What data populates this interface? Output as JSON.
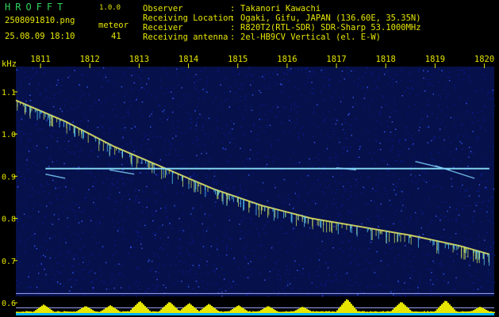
{
  "header": {
    "logo": "HROFFT",
    "version": "1.0.0",
    "filename": "2508091810.png",
    "datetime": "25.08.09 18:10",
    "meteor_label": "meteor",
    "meteor_count": "41",
    "info": [
      {
        "label": "Observer",
        "value": "Takanori Kawachi"
      },
      {
        "label": "Receiving Location",
        "value": "Ogaki, Gifu, JAPAN (136.60E, 35.35N)"
      },
      {
        "label": "Receiver",
        "value": "R820T2(RTL-SDR) SDR-Sharp 53.1000MHz"
      },
      {
        "label": "Receiving antenna",
        "value": "2el-HB9CV Vertical (el. E-W)"
      }
    ]
  },
  "colors": {
    "background": "#000000",
    "text": "#e6e600",
    "logo": "#2fd35a",
    "noise": "#0a1a8c",
    "signal": "#e0e060",
    "level_bar": "#e6e600",
    "level_base": "#00b4ff",
    "guide_line": "#9ea8ff"
  },
  "chart_data": {
    "type": "heatmap",
    "ylabel": "kHz",
    "x_ticks": [
      "1811",
      "1812",
      "1813",
      "1814",
      "1815",
      "1816",
      "1817",
      "1818",
      "1819",
      "1820"
    ],
    "y_ticks": [
      "1.1",
      "1.0",
      "0.9",
      "0.8",
      "0.7",
      "0.6"
    ],
    "xlim": [
      "1810.5",
      "1820.2"
    ],
    "ylim": [
      0.57,
      1.16
    ],
    "traces": [
      {
        "kind": "drifting_carrier",
        "points": [
          [
            1810.5,
            1.08
          ],
          [
            1811.5,
            1.03
          ],
          [
            1812.5,
            0.97
          ],
          [
            1813.5,
            0.92
          ],
          [
            1814.5,
            0.87
          ],
          [
            1815.5,
            0.83
          ],
          [
            1816.5,
            0.8
          ],
          [
            1817.5,
            0.78
          ],
          [
            1818.5,
            0.76
          ],
          [
            1819.5,
            0.735
          ],
          [
            1820.1,
            0.715
          ]
        ]
      },
      {
        "kind": "constant_carrier",
        "freq": 0.918,
        "x_start": 1811.1,
        "x_end": 1820.1
      },
      {
        "kind": "meteor_echo",
        "x_start": 1811.1,
        "x_end": 1811.5,
        "f_start": 0.905,
        "f_end": 0.895
      },
      {
        "kind": "meteor_echo",
        "x_start": 1812.4,
        "x_end": 1812.9,
        "f_start": 0.915,
        "f_end": 0.905
      },
      {
        "kind": "meteor_echo",
        "x_start": 1817.0,
        "x_end": 1817.4,
        "f_start": 0.92,
        "f_end": 0.915
      },
      {
        "kind": "meteor_echo",
        "x_start": 1818.6,
        "x_end": 1819.3,
        "f_start": 0.935,
        "f_end": 0.915
      },
      {
        "kind": "meteor_echo",
        "x_start": 1819.0,
        "x_end": 1819.8,
        "f_start": 0.925,
        "f_end": 0.895
      }
    ],
    "level_peaks": [
      {
        "x": 1811.05,
        "height": 0.6
      },
      {
        "x": 1811.9,
        "height": 0.5
      },
      {
        "x": 1812.4,
        "height": 0.55
      },
      {
        "x": 1813.0,
        "height": 0.85
      },
      {
        "x": 1813.6,
        "height": 0.8
      },
      {
        "x": 1814.0,
        "height": 0.7
      },
      {
        "x": 1814.4,
        "height": 0.65
      },
      {
        "x": 1815.0,
        "height": 0.55
      },
      {
        "x": 1815.6,
        "height": 0.5
      },
      {
        "x": 1816.3,
        "height": 0.45
      },
      {
        "x": 1817.2,
        "height": 1.0
      },
      {
        "x": 1818.3,
        "height": 0.8
      },
      {
        "x": 1819.2,
        "height": 0.9
      },
      {
        "x": 1819.9,
        "height": 0.45
      }
    ]
  }
}
